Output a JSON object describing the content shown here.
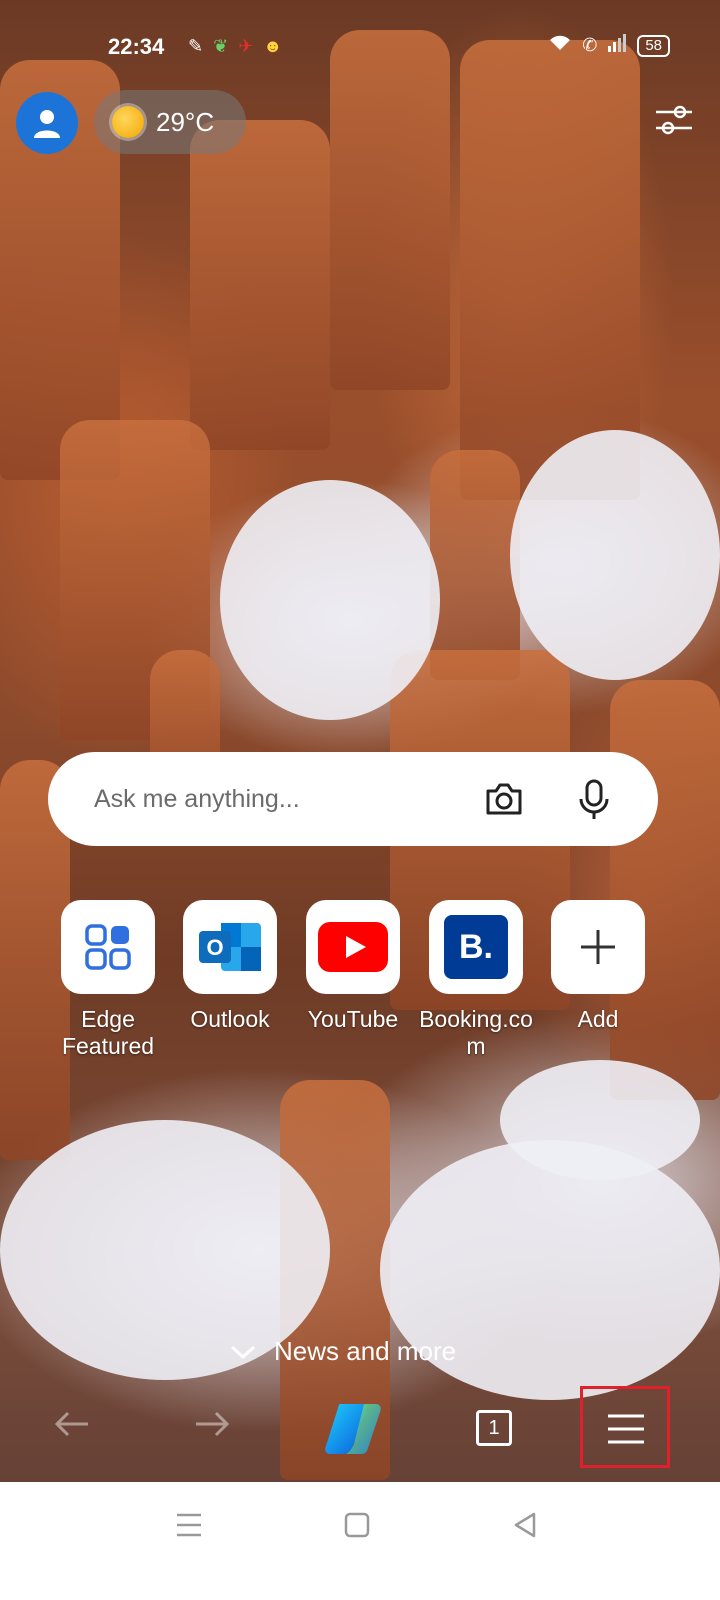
{
  "status_bar": {
    "time": "22:34",
    "battery": "58",
    "notification_icons": [
      "app-icon-1",
      "app-icon-2",
      "app-icon-3",
      "app-icon-4"
    ],
    "system_icons": [
      "wifi-icon",
      "call-icon",
      "signal-icon",
      "battery-icon"
    ]
  },
  "header": {
    "weather": {
      "temperature": "29°C",
      "icon": "partly-sunny-icon"
    },
    "profile_icon": "profile-icon",
    "settings_icon": "page-settings-icon"
  },
  "search": {
    "placeholder": "Ask me anything...",
    "camera_icon": "camera-icon",
    "mic_icon": "microphone-icon"
  },
  "quick_links": [
    {
      "label": "Edge\nFeatured",
      "icon": "grid-icon"
    },
    {
      "label": "Outlook",
      "icon": "outlook-icon"
    },
    {
      "label": "YouTube",
      "icon": "youtube-icon"
    },
    {
      "label": "Booking.co\nm",
      "icon": "booking-icon"
    },
    {
      "label": "Add",
      "icon": "plus-icon"
    }
  ],
  "news": {
    "label": "News and more"
  },
  "toolbar": {
    "tab_count": "1",
    "highlight_color": "#e0202a"
  },
  "colors": {
    "accent": "#1d74d8",
    "youtube_red": "#ff0000",
    "booking_blue": "#003b95"
  }
}
